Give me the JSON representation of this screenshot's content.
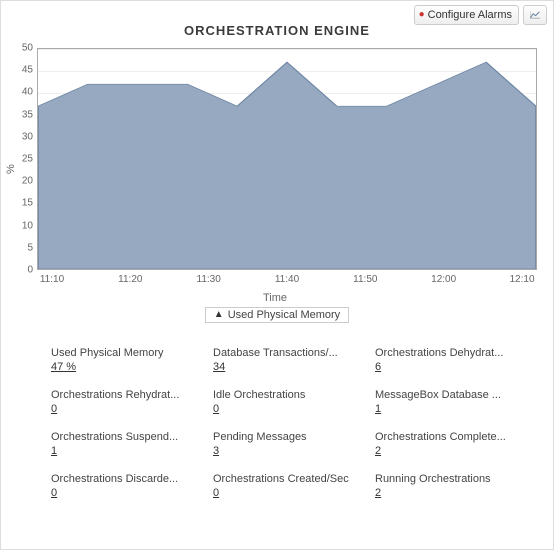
{
  "toolbar": {
    "configure_alarms_label": "Configure Alarms"
  },
  "title": "ORCHESTRATION ENGINE",
  "ylabel": "%",
  "xlabel": "Time",
  "legend_label": "Used Physical Memory",
  "chart_data": {
    "type": "area",
    "x": [
      "11:10",
      "11:20",
      "11:30",
      "11:40",
      "11:50",
      "12:00",
      "12:10"
    ],
    "series": [
      {
        "name": "Used Physical Memory",
        "values": [
          37,
          42,
          42,
          42,
          37,
          47,
          37,
          37,
          42,
          47,
          37
        ],
        "x_points": [
          "start",
          "11:10",
          "11:20",
          "11:30",
          "11:40",
          "11:50",
          "~11:55",
          "12:00",
          "~12:05",
          "12:10",
          "end"
        ]
      }
    ],
    "ylim": [
      0,
      50
    ],
    "yticks": [
      0,
      5,
      10,
      15,
      20,
      25,
      30,
      35,
      40,
      45,
      50
    ],
    "xlabel": "Time",
    "ylabel": "%",
    "title": "ORCHESTRATION ENGINE"
  },
  "metrics": [
    {
      "label": "Used Physical Memory",
      "value": "47 %"
    },
    {
      "label": "Database Transactions/...",
      "value": "34"
    },
    {
      "label": "Orchestrations Dehydrat...",
      "value": "6"
    },
    {
      "label": "Orchestrations Rehydrat...",
      "value": "0"
    },
    {
      "label": "Idle Orchestrations",
      "value": "0"
    },
    {
      "label": "MessageBox Database ...",
      "value": "1"
    },
    {
      "label": "Orchestrations Suspend...",
      "value": "1"
    },
    {
      "label": "Pending Messages",
      "value": "3"
    },
    {
      "label": "Orchestrations Complete...",
      "value": "2"
    },
    {
      "label": "Orchestrations Discarde...",
      "value": "0"
    },
    {
      "label": "Orchestrations Created/Sec",
      "value": "0"
    },
    {
      "label": "Running Orchestrations",
      "value": "2"
    }
  ]
}
